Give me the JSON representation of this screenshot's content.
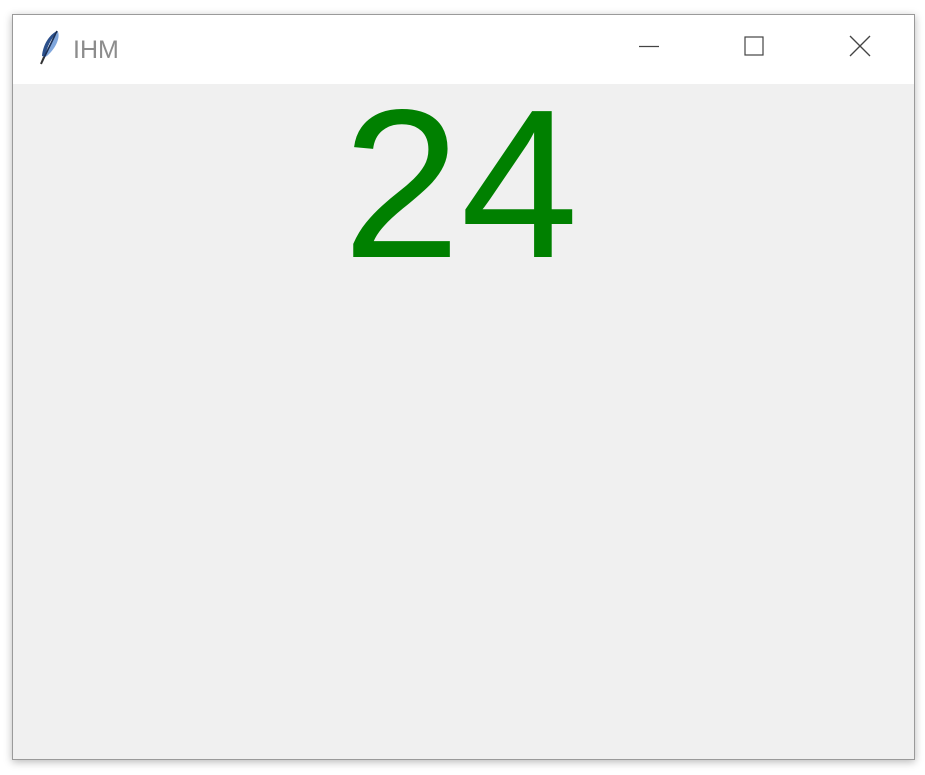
{
  "window": {
    "title": "IHM",
    "icon": "feather-icon",
    "controls": {
      "minimize_icon": "minimize-icon",
      "maximize_icon": "maximize-icon",
      "close_icon": "close-icon"
    }
  },
  "content": {
    "counter_value": "24",
    "counter_color": "#008000"
  }
}
